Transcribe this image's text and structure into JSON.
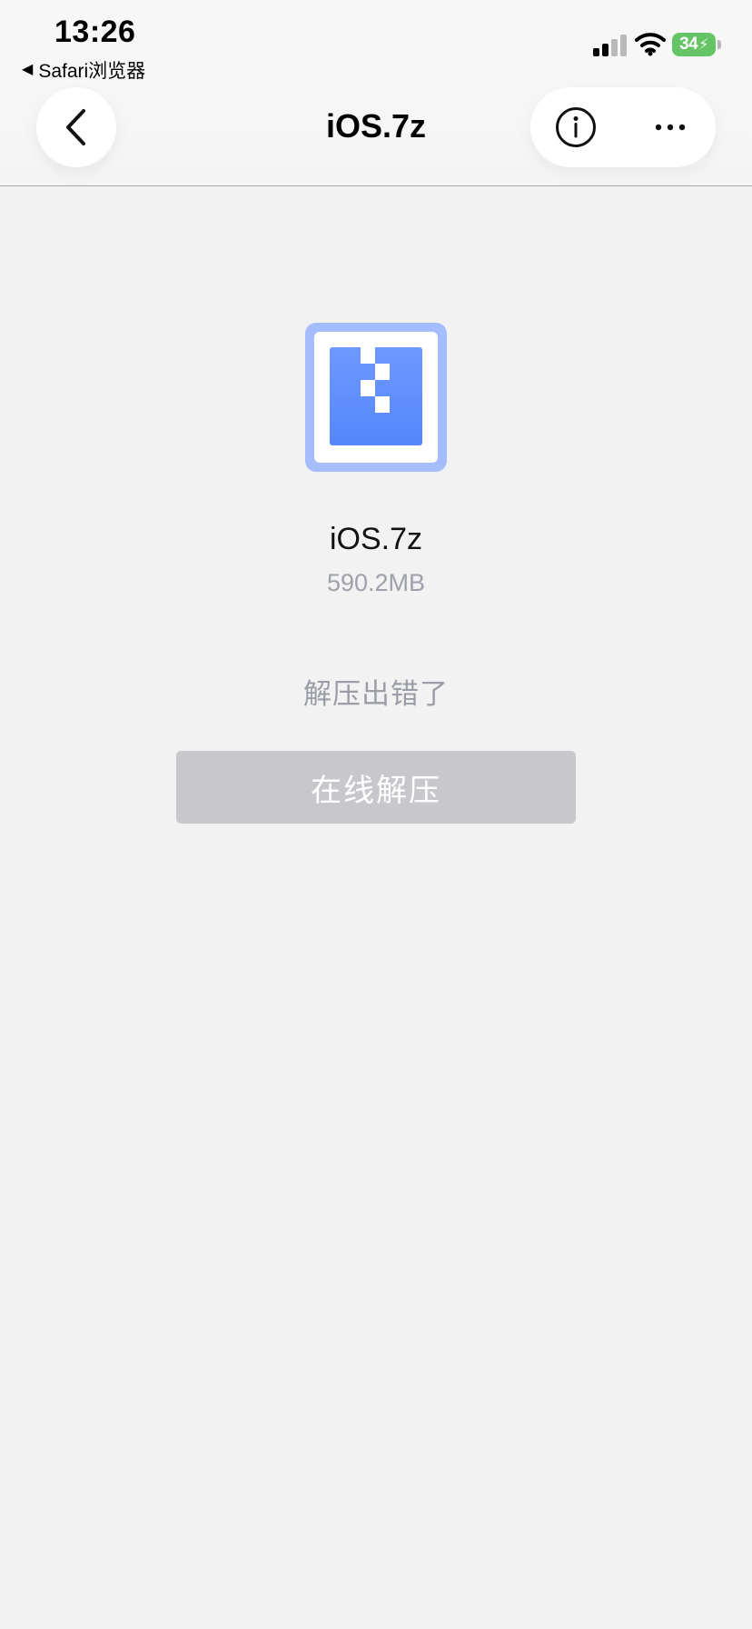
{
  "status_bar": {
    "time": "13:26",
    "back_app_label": "Safari浏览器",
    "battery_level": "34",
    "battery_color": "#64c466"
  },
  "nav_bar": {
    "title": "iOS.7z",
    "back_icon": "chevron-left-icon",
    "info_icon": "info-icon",
    "more_icon": "more-icon"
  },
  "file": {
    "name": "iOS.7z",
    "size": "590.2MB",
    "icon": "archive-file-icon",
    "accent_color": "#5b8cff"
  },
  "status_message": "解压出错了",
  "actions": {
    "online_extract_label": "在线解压"
  }
}
